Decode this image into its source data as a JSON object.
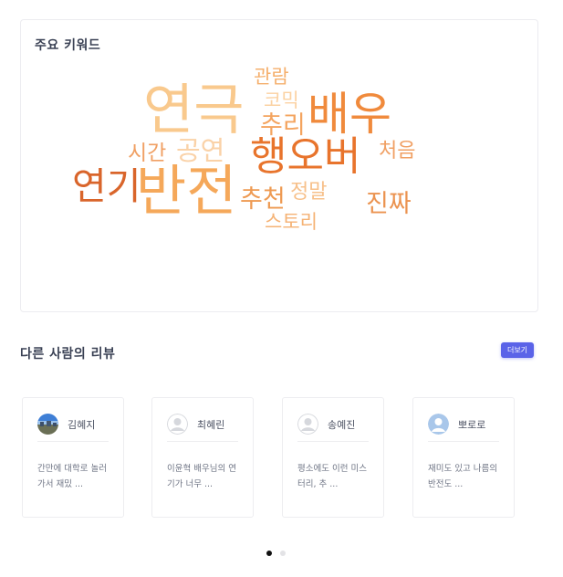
{
  "keywords": {
    "title": "주요 키워드",
    "words": [
      {
        "text": "관람",
        "color": "#f5b06e"
      },
      {
        "text": "연극",
        "color": "#f9c98d"
      },
      {
        "text": "코믹",
        "color": "#fbd2a3"
      },
      {
        "text": "배우",
        "color": "#f08a3c"
      },
      {
        "text": "추리",
        "color": "#f4a45f"
      },
      {
        "text": "시간",
        "color": "#f0a064"
      },
      {
        "text": "공연",
        "color": "#fad2a8"
      },
      {
        "text": "행오버",
        "color": "#e8742c"
      },
      {
        "text": "처음",
        "color": "#f0a064"
      },
      {
        "text": "연기",
        "color": "#d9652b"
      },
      {
        "text": "반전",
        "color": "#f5a85a"
      },
      {
        "text": "추천",
        "color": "#ee9a52"
      },
      {
        "text": "정말",
        "color": "#f7c08a"
      },
      {
        "text": "진짜",
        "color": "#eb9350"
      },
      {
        "text": "스토리",
        "color": "#f5b274"
      }
    ]
  },
  "reviews": {
    "title": "다른 사람의 리뷰",
    "more_label": "더보기",
    "items": [
      {
        "name": "김혜지",
        "avatar": "photo-avatar",
        "snippet": "간만에 대학로 놀러가서 재밌 ..."
      },
      {
        "name": "최혜린",
        "avatar": "default-avatar",
        "snippet": "이윤혁 배우님의 연기가 너무 ..."
      },
      {
        "name": "송예진",
        "avatar": "default-avatar",
        "snippet": "평소에도 이런 미스터리, 추 ..."
      },
      {
        "name": "뽀로로",
        "avatar": "blue-avatar",
        "snippet": "재미도 있고 나름의 반전도 ..."
      }
    ]
  },
  "carousel": {
    "page_count": 2,
    "active_index": 0,
    "active_color": "#111111",
    "inactive_color": "#e3e3e6"
  },
  "colors": {
    "accent": "#5a63e8"
  }
}
